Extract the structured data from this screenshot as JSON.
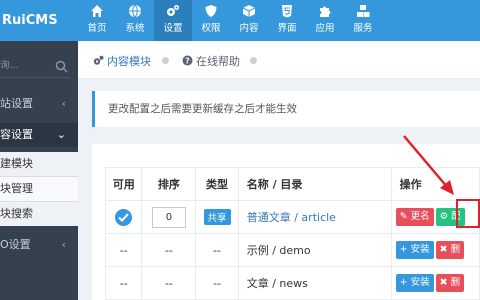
{
  "app": {
    "logo_text": "RuiCMS",
    "logo_mark": "⚙"
  },
  "nav": {
    "items": [
      {
        "label": "首页",
        "icon": "home-icon"
      },
      {
        "label": "系统",
        "icon": "globe-icon"
      },
      {
        "label": "设置",
        "icon": "gears-icon",
        "active": true
      },
      {
        "label": "权限",
        "icon": "shield-icon"
      },
      {
        "label": "内容",
        "icon": "cube-icon"
      },
      {
        "label": "界面",
        "icon": "html5-icon"
      },
      {
        "label": "应用",
        "icon": "puzzle-icon"
      },
      {
        "label": "服务",
        "icon": "cubes-icon"
      }
    ]
  },
  "sidebar": {
    "search_placeholder": "询...",
    "items": [
      {
        "label": "站设置",
        "chevron": "‹"
      },
      {
        "label": "容设置",
        "chevron": "⌄",
        "active": true
      },
      {
        "label": "建模块"
      },
      {
        "label": "块管理",
        "current": true
      },
      {
        "label": "块搜索"
      },
      {
        "label": "O设置",
        "chevron": "‹"
      }
    ]
  },
  "breadcrumb": {
    "items": [
      {
        "label": "内容模块",
        "icon": "gears-icon"
      },
      {
        "label": "在线帮助",
        "icon": "question-icon"
      }
    ]
  },
  "notice": {
    "text": "更改配置之后需要更新缓存之后才能生效"
  },
  "table": {
    "headers": [
      "可用",
      "排序",
      "类型",
      "名称 / 目录",
      "操作"
    ],
    "rows": [
      {
        "enabled": true,
        "order": "0",
        "type": "共享",
        "name": "普通文章 / article",
        "actions": [
          "更名",
          "配"
        ]
      },
      {
        "enabled": null,
        "enabled_text": "--",
        "order": "--",
        "type": "--",
        "name": "示例 / demo",
        "actions": [
          "安装",
          "删"
        ]
      },
      {
        "enabled": null,
        "enabled_text": "--",
        "order": "--",
        "type": "--",
        "name": "文章 / news",
        "actions": [
          "安装",
          "删"
        ]
      }
    ]
  },
  "colors": {
    "primary": "#3598dc",
    "sidebar": "#364150",
    "danger": "#e7505a",
    "success": "#26c281",
    "highlight": "#e0202a"
  }
}
